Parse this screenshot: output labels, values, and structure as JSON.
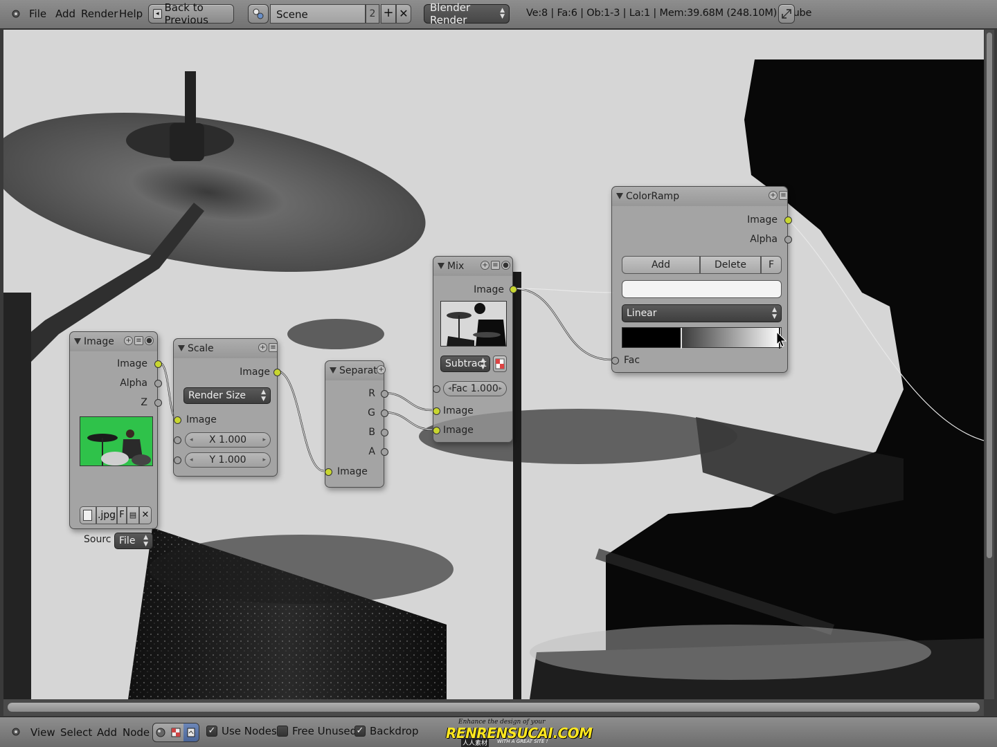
{
  "header": {
    "menus": [
      "File",
      "Add",
      "Render",
      "Help"
    ],
    "back_label": "Back to Previous",
    "scene_value": "Scene",
    "scene_users": "2",
    "engine_value": "Blender Render",
    "info": "Ve:8 | Fa:6 | Ob:1-3 | La:1 | Mem:39.68M (248.10M) | Cube"
  },
  "nodes": {
    "image": {
      "title": "Image",
      "out_image": "Image",
      "out_alpha": "Alpha",
      "out_z": "Z",
      "file_ext": ".jpg",
      "fake_user": "F",
      "source_label": "Sourc",
      "source_value": "File"
    },
    "scale": {
      "title": "Scale",
      "out_image": "Image",
      "space_value": "Render Size",
      "in_image": "Image",
      "x_value": "X 1.000",
      "y_value": "Y 1.000"
    },
    "separate": {
      "title": "Separat",
      "out_r": "R",
      "out_g": "G",
      "out_b": "B",
      "out_a": "A",
      "in_image": "Image"
    },
    "mix": {
      "title": "Mix",
      "out_image": "Image",
      "blend_value": "Subtract",
      "fac_value": "Fac 1.000",
      "in_image1": "Image",
      "in_image2": "Image"
    },
    "colorramp": {
      "title": "ColorRamp",
      "out_image": "Image",
      "out_alpha": "Alpha",
      "add_label": "Add",
      "delete_label": "Delete",
      "flip_label": "F",
      "interp_value": "Linear",
      "in_fac": "Fac"
    }
  },
  "footer": {
    "menus": [
      "View",
      "Select",
      "Add",
      "Node"
    ],
    "use_nodes": "Use Nodes",
    "free_unused": "Free Unused",
    "backdrop": "Backdrop",
    "use_nodes_checked": true,
    "free_unused_checked": false,
    "backdrop_checked": true,
    "watermark_top": "Enhance the design of your",
    "watermark_main": "RENRENSUCAI.COM",
    "watermark_cn": "人人素材",
    "watermark_sub": "WITH A GREAT SITE !"
  },
  "colors": {
    "socket_image": "#c8d630",
    "socket_value": "#a0a0a0",
    "thumb_green": "#2fc24a"
  }
}
